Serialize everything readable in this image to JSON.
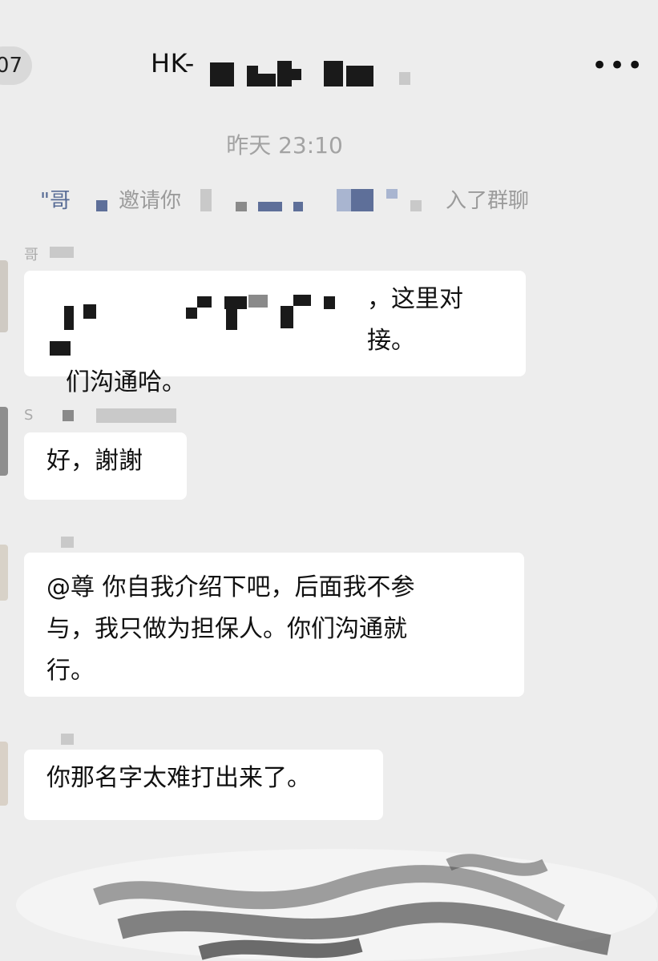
{
  "header": {
    "back_badge": "07",
    "title": "HK-",
    "more_icon": "more-dots"
  },
  "chat": {
    "time_label": "昨天 23:10",
    "system_message": {
      "prefix": "\"哥",
      "invite_text": "邀请你",
      "suffix": "入了群聊"
    },
    "messages": [
      {
        "sender": "哥",
        "lines": [
          "，这里对接。",
          "们沟通哈。"
        ]
      },
      {
        "sender": "S",
        "lines": [
          "好，謝謝"
        ]
      },
      {
        "sender": "",
        "lines": [
          "@尊 你自我介绍下吧，后面我不参",
          "与，我只做为担保人。你们沟通就",
          "行。"
        ]
      },
      {
        "sender": "",
        "lines": [
          "你那名字太难打出来了。"
        ]
      }
    ]
  },
  "colors": {
    "background": "#ededed",
    "bubble": "#ffffff",
    "link_blue": "#576b95",
    "muted_text": "#a3a3a3"
  }
}
